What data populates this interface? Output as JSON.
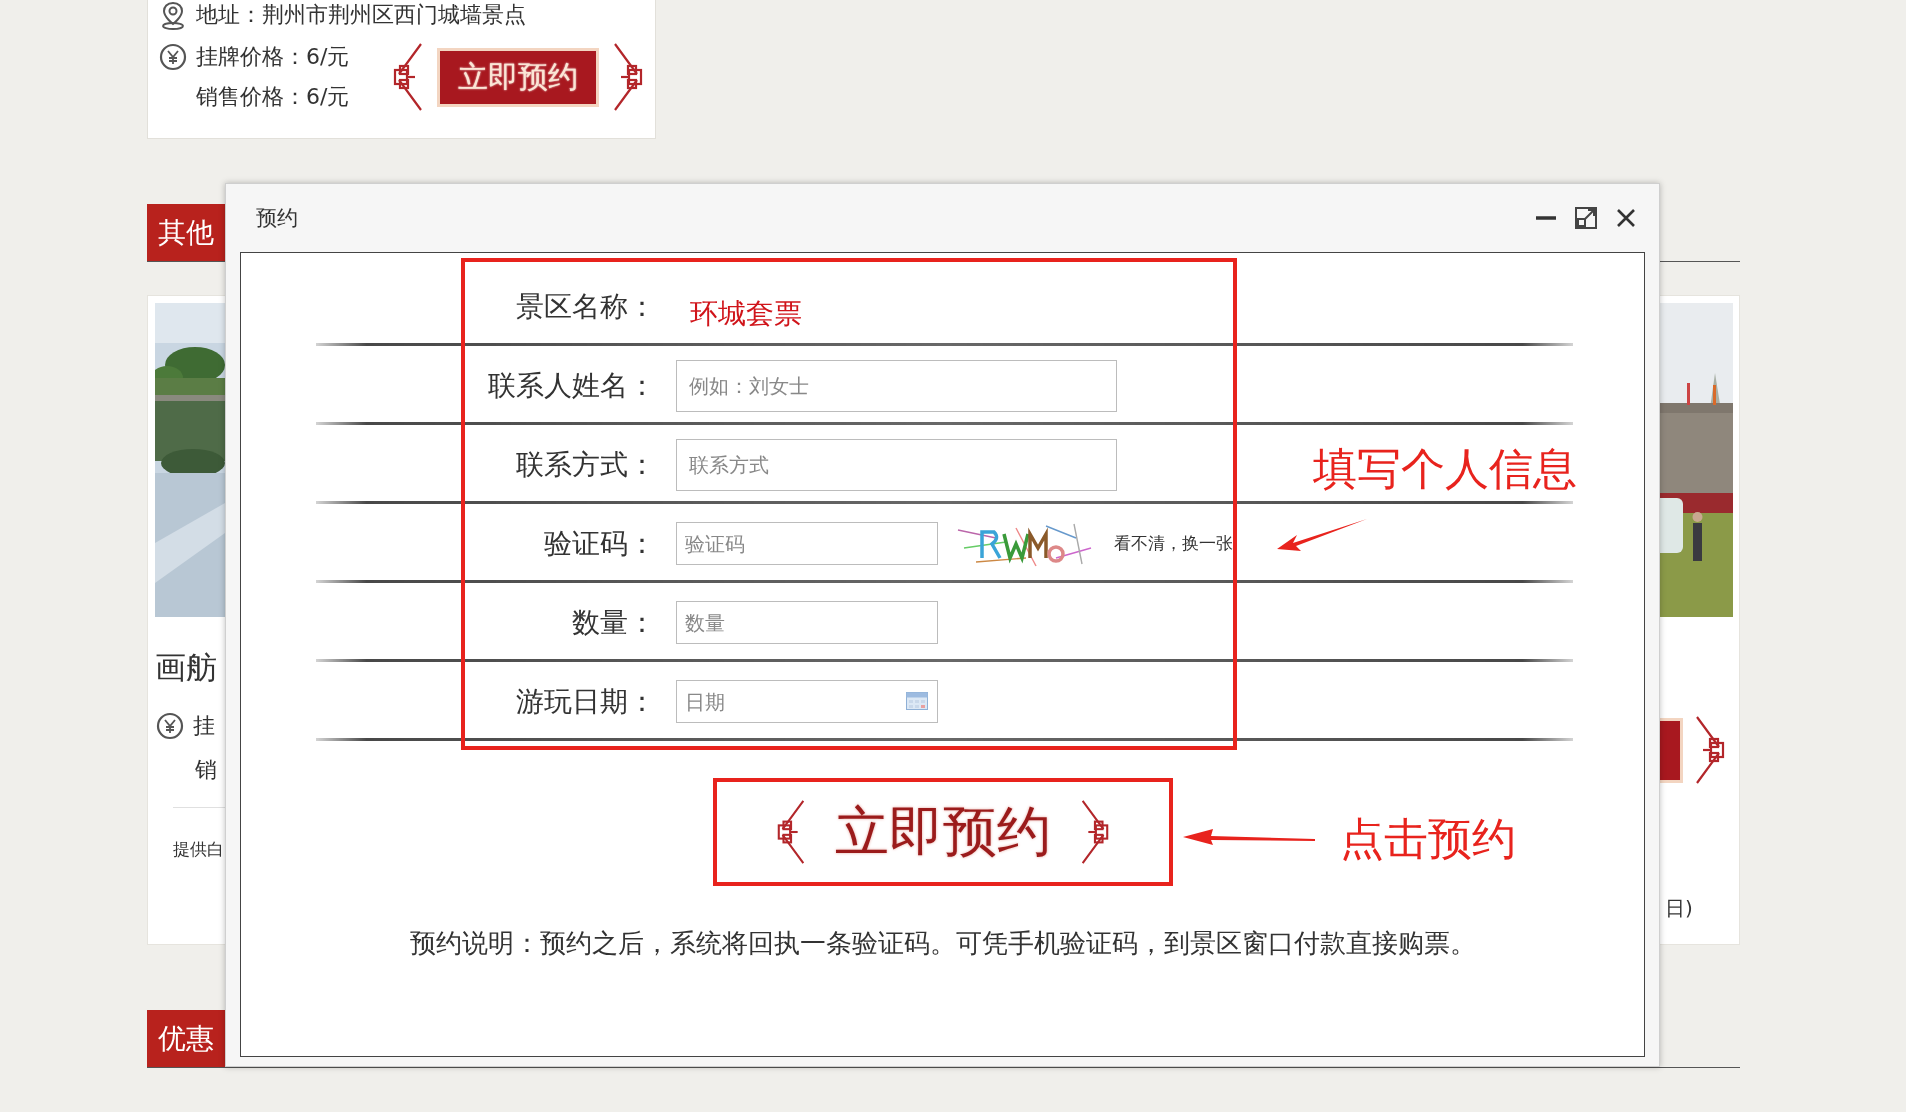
{
  "top_card": {
    "address": "地址：荆州市荆州区西门城墙景点",
    "list_price": "挂牌价格：6/元",
    "sale_price": "销售价格：6/元",
    "button": "立即预约"
  },
  "sections": [
    {
      "title": "其他"
    },
    {
      "title": "优惠"
    }
  ],
  "left_card": {
    "title": "画舫",
    "list_price": "挂",
    "sale_price": "销",
    "note": "提供白"
  },
  "right_card": {
    "note": "日)"
  },
  "dialog": {
    "title": "预约",
    "fields": [
      {
        "kind": "static",
        "label": "景区名称：",
        "value": "环城套票"
      },
      {
        "kind": "long",
        "label": "联系人姓名：",
        "placeholder": "例如：刘女士"
      },
      {
        "kind": "long",
        "label": "联系方式：",
        "placeholder": "联系方式"
      },
      {
        "kind": "captcha",
        "label": "验证码：",
        "placeholder": "验证码",
        "refresh_link": "看不清，换一张"
      },
      {
        "kind": "short",
        "label": "数量：",
        "placeholder": "数量"
      },
      {
        "kind": "date",
        "label": "游玩日期：",
        "placeholder": "日期"
      }
    ],
    "submit": "立即预约",
    "note": "预约说明：预约之后，系统将回执一条验证码。可凭手机验证码，到景区窗口付款直接购票。",
    "annotations": [
      {
        "kind": "fields",
        "text": "填写个人信息"
      },
      {
        "kind": "button",
        "text": "点击预约"
      }
    ]
  }
}
